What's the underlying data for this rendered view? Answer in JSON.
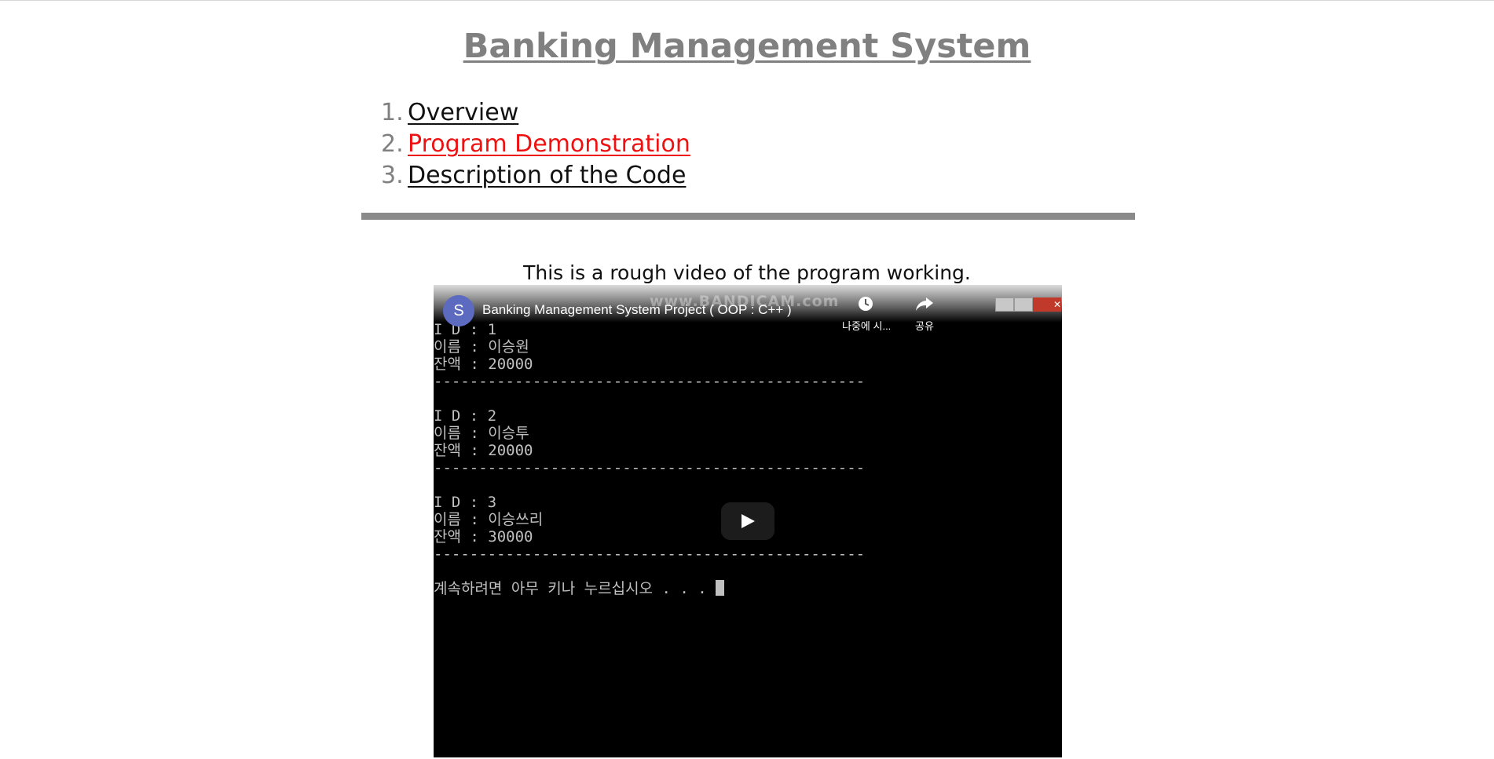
{
  "page": {
    "title": "Banking Management System"
  },
  "toc": {
    "items": [
      {
        "num": "1.",
        "label": "Overview",
        "active": false
      },
      {
        "num": "2.",
        "label": "Program Demonstration",
        "active": true
      },
      {
        "num": "3.",
        "label": "Description of the Code",
        "active": false
      }
    ]
  },
  "demo": {
    "caption": "This is a rough video of the program working."
  },
  "video": {
    "channel_initial": "S",
    "title": "Banking Management System Project ( OOP : C++ )",
    "watermark": "www.BANDICAM.com",
    "watch_later_label": "나중에 시...",
    "share_label": "공유",
    "console_lines": [
      "I D : 1",
      "이름 : 이승원",
      "잔액 : 20000",
      "------------------------------------------------",
      "",
      "I D : 2",
      "이름 : 이승투",
      "잔액 : 20000",
      "------------------------------------------------",
      "",
      "I D : 3",
      "이름 : 이승쓰리",
      "잔액 : 30000",
      "------------------------------------------------",
      "",
      "계속하려면 아무 키나 누르십시오 . . . "
    ]
  },
  "colors": {
    "title": "#808080",
    "active_link": "#ee1111",
    "link": "#111111",
    "divider": "#8a8a8a",
    "video_bg": "#000000",
    "avatar": "#5c6bc0"
  },
  "icons": {
    "play": "play-icon",
    "watch_later": "clock-icon",
    "share": "share-icon"
  }
}
